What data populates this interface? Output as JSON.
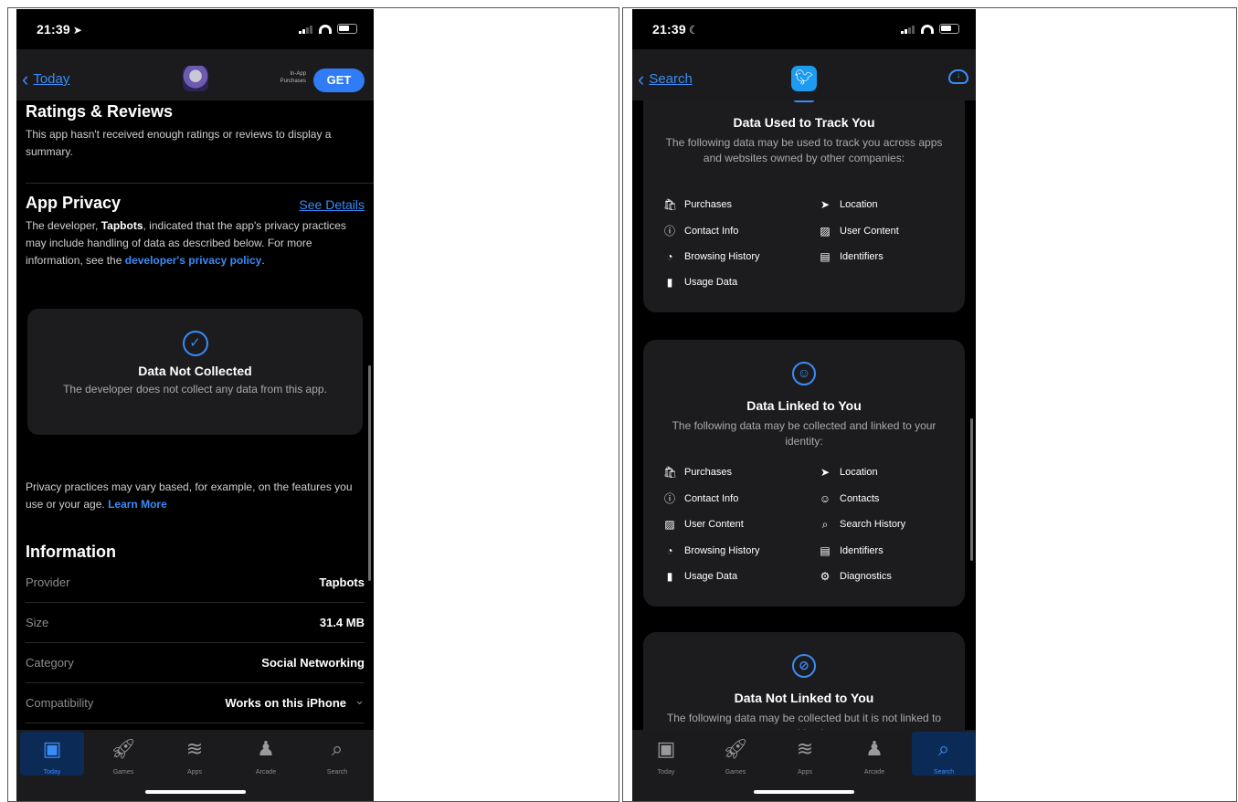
{
  "left": {
    "status": {
      "time": "21:39",
      "time_glyph": "➤"
    },
    "nav": {
      "back_label": "Today",
      "iap_label": "In-App Purchases",
      "get_label": "GET"
    },
    "ratings": {
      "title": "Ratings & Reviews",
      "text": "This app hasn't received enough ratings or reviews to display a summary."
    },
    "privacy": {
      "title": "App Privacy",
      "see_details": "See Details",
      "text_pre": "The developer, ",
      "developer": "Tapbots",
      "text_post": ", indicated that the app's privacy practices may include handling of data as described below. For more information, see the ",
      "policy_link": "developer's privacy policy",
      "policy_end": ".",
      "card_title": "Data Not Collected",
      "card_text": "The developer does not collect any data from this app.",
      "vary_text": "Privacy practices may vary based, for example, on the features you use or your age. ",
      "learn_more": "Learn More"
    },
    "information": {
      "title": "Information",
      "rows": [
        {
          "key": "Provider",
          "value": "Tapbots"
        },
        {
          "key": "Size",
          "value": "31.4 MB"
        },
        {
          "key": "Category",
          "value": "Social Networking"
        },
        {
          "key": "Compatibility",
          "value": "Works on this iPhone"
        }
      ]
    },
    "tabs": [
      "Today",
      "Games",
      "Apps",
      "Arcade",
      "Search"
    ]
  },
  "right": {
    "status": {
      "time": "21:39",
      "time_glyph": "☾"
    },
    "nav": {
      "back_label": "Search"
    },
    "track": {
      "title": "Data Used to Track You",
      "text": "The following data may be used to track you across apps and websites owned by other companies:",
      "items": [
        "Purchases",
        "Location",
        "Contact Info",
        "User Content",
        "Browsing History",
        "Identifiers",
        "Usage Data"
      ]
    },
    "linked": {
      "title": "Data Linked to You",
      "text": "The following data may be collected and linked to your identity:",
      "items": [
        "Purchases",
        "Location",
        "Contact Info",
        "Contacts",
        "User Content",
        "Search History",
        "Browsing History",
        "Identifiers",
        "Usage Data",
        "Diagnostics"
      ]
    },
    "not_linked": {
      "title": "Data Not Linked to You",
      "text": "The following data may be collected but it is not linked to your identity:"
    },
    "tabs": [
      "Today",
      "Games",
      "Apps",
      "Arcade",
      "Search"
    ]
  },
  "colors": {
    "accent": "#3b8bf7",
    "background": "#000000",
    "card": "#1c1c1e",
    "bar": "#1b1b1d"
  }
}
